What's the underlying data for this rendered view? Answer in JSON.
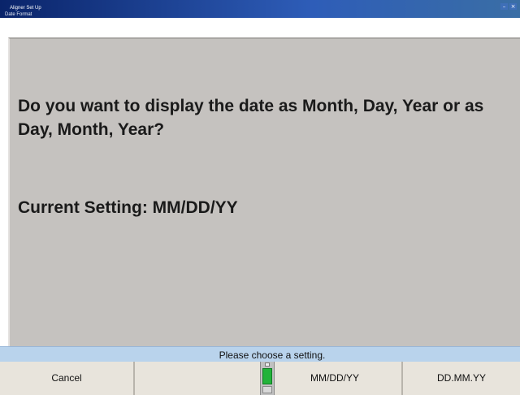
{
  "window": {
    "title": "Aligner Set Up",
    "subtitle": "Date Format",
    "minimize_glyph": "–",
    "close_glyph": "×"
  },
  "main": {
    "question": "Do you want to display the date as Month, Day, Year or as Day, Month, Year?",
    "current_setting": "Current Setting: MM/DD/YY"
  },
  "status": {
    "message": "Please choose a setting."
  },
  "softkeys": {
    "cancel": "Cancel",
    "empty": "",
    "mmddyy": "MM/DD/YY",
    "ddmmyy": "DD.MM.YY"
  },
  "colors": {
    "content_bg": "#c5c2bf",
    "status_bg": "#b9d3ec",
    "softkey_bg": "#e8e4dc",
    "title_bar": "#0a246a",
    "indicator_green": "#22b33a"
  }
}
